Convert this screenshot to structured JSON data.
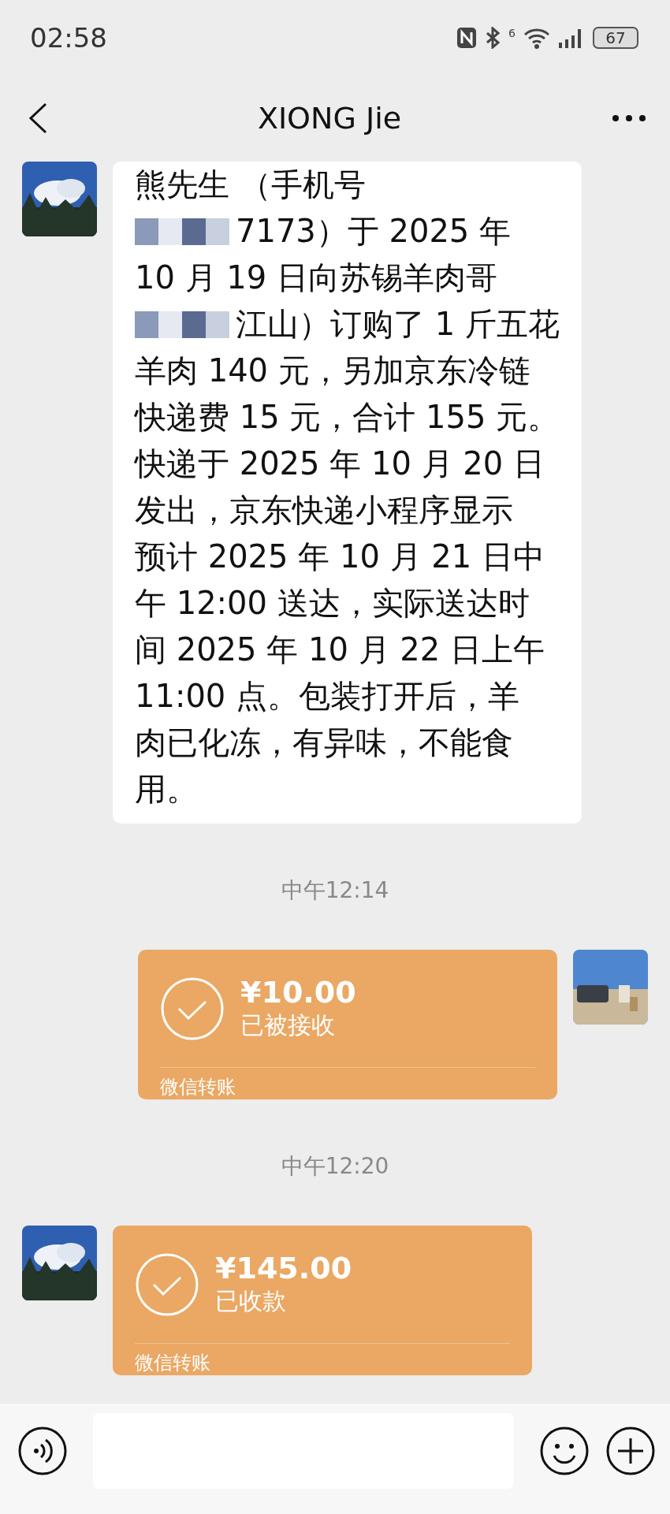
{
  "status_bar": {
    "time": "02:58",
    "battery": "67",
    "wifi_badge": "6"
  },
  "header": {
    "title": "XIONG Jie"
  },
  "messages": [
    {
      "kind": "text",
      "outgoing": false,
      "lines": [
        {
          "text": "熊先生 （手机号",
          "redacted": false
        },
        {
          "text": "7173）于 2025 年",
          "redacted": true
        },
        {
          "text": "10 月 19 日向苏锡羊肉哥",
          "redacted": false
        },
        {
          "text": "江山）订购了 1 斤五花",
          "redacted": true
        },
        {
          "text": "羊肉 140 元，另加京东冷链",
          "redacted": false
        },
        {
          "text": "快递费 15 元，合计 155 元。",
          "redacted": false
        },
        {
          "text": "快递于 2025 年 10 月 20 日",
          "redacted": false
        },
        {
          "text": "发出，京东快递小程序显示",
          "redacted": false
        },
        {
          "text": "预计 2025 年 10 月 21 日中",
          "redacted": false
        },
        {
          "text": "午 12:00 送达，实际送达时",
          "redacted": false
        },
        {
          "text": "间 2025 年 10 月 22 日上午",
          "redacted": false
        },
        {
          "text": "11:00 点。包装打开后，羊",
          "redacted": false
        },
        {
          "text": "肉已化冻，有异味，不能食",
          "redacted": false
        },
        {
          "text": "用。",
          "redacted": false
        }
      ]
    },
    {
      "kind": "time",
      "text": "中午12:14"
    },
    {
      "kind": "transfer",
      "outgoing": true,
      "amount": "¥10.00",
      "status": "已被接收",
      "footer": "微信转账"
    },
    {
      "kind": "time",
      "text": "中午12:20"
    },
    {
      "kind": "transfer",
      "outgoing": false,
      "amount": "¥145.00",
      "status": "已收款",
      "footer": "微信转账"
    }
  ]
}
